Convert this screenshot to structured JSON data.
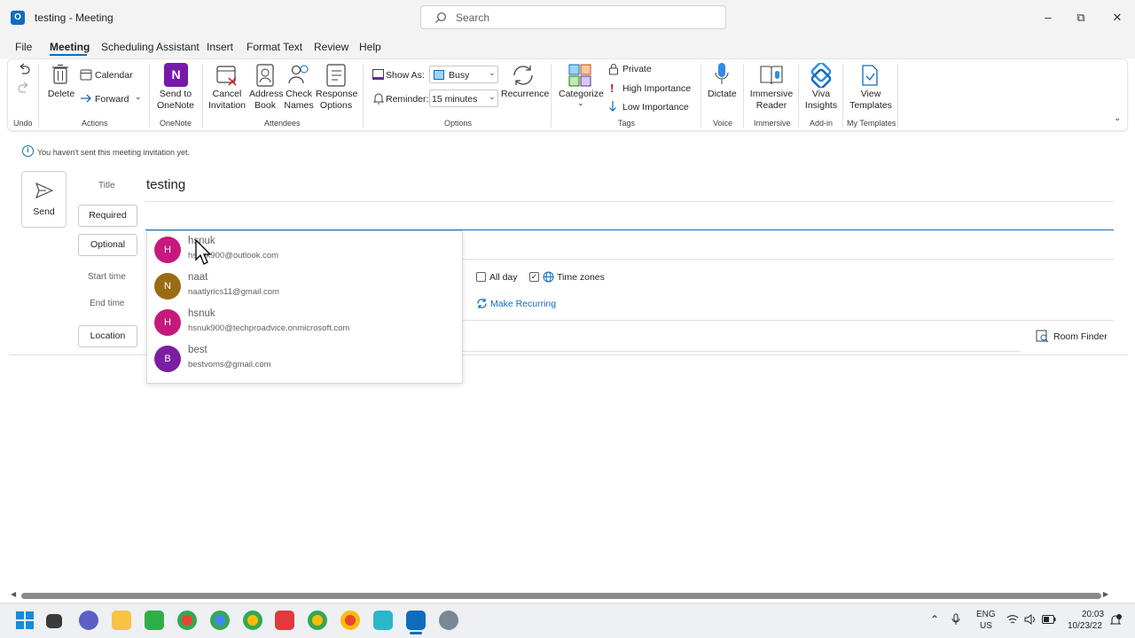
{
  "window": {
    "title": "testing  -  Meeting",
    "search_placeholder": "Search"
  },
  "menu": [
    "File",
    "Meeting",
    "Scheduling Assistant",
    "Insert",
    "Format Text",
    "Review",
    "Help"
  ],
  "ribbon": {
    "undo": {
      "label": "Undo"
    },
    "actions": {
      "delete": "Delete",
      "calendar": "Calendar",
      "forward": "Forward",
      "group": "Actions"
    },
    "onenote": {
      "send_line1": "Send to",
      "send_line2": "OneNote",
      "group": "OneNote"
    },
    "attendees": {
      "cancel1": "Cancel",
      "cancel2": "Invitation",
      "address1": "Address",
      "address2": "Book",
      "check1": "Check",
      "check2": "Names",
      "response1": "Response",
      "response2": "Options",
      "group": "Attendees"
    },
    "options": {
      "show_as_label": "Show As:",
      "show_as_value": "Busy",
      "reminder_label": "Reminder:",
      "reminder_value": "15 minutes",
      "recurrence": "Recurrence",
      "group": "Options"
    },
    "tags": {
      "categorize": "Categorize",
      "private": "Private",
      "high": "High Importance",
      "low": "Low Importance",
      "group": "Tags"
    },
    "voice": {
      "dictate": "Dictate",
      "group": "Voice"
    },
    "immersive": {
      "line1": "Immersive",
      "line2": "Reader",
      "group": "Immersive"
    },
    "addin": {
      "line1": "Viva",
      "line2": "Insights",
      "group": "Add-in"
    },
    "templates": {
      "line1": "View",
      "line2": "Templates",
      "group": "My Templates"
    }
  },
  "form": {
    "info": "You haven't sent this meeting invitation yet.",
    "send": "Send",
    "title_label": "Title",
    "title_value": "testing",
    "required": "Required",
    "optional": "Optional",
    "start_time": "Start time",
    "end_time": "End time",
    "location": "Location",
    "all_day": "All day",
    "time_zones": "Time zones",
    "make_recurring": "Make Recurring",
    "room_finder": "Room Finder"
  },
  "suggestions": [
    {
      "initial": "H",
      "name": "hsnuk",
      "email": "hsnuk900@outlook.com",
      "color": "#c5197d"
    },
    {
      "initial": "N",
      "name": "naat",
      "email": "naatlyrics11@gmail.com",
      "color": "#9a6c12"
    },
    {
      "initial": "H",
      "name": "hsnuk",
      "email": "hsnuk900@techproadvice.onmicrosoft.com",
      "color": "#c5197d"
    },
    {
      "initial": "B",
      "name": "best",
      "email": "bestvoms@gmail.com",
      "color": "#7b1fa2"
    }
  ],
  "taskbar": {
    "lang1": "ENG",
    "lang2": "US",
    "time": "20:03",
    "date": "10/23/22"
  }
}
